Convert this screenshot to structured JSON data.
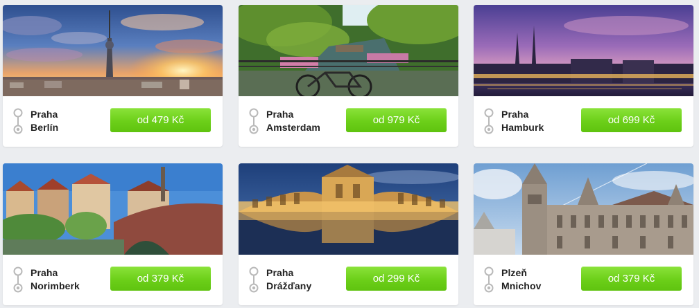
{
  "cards": [
    {
      "from": "Praha",
      "to": "Berlín",
      "price": "od 479 Kč",
      "image": "berlin-skyline-sunset-image"
    },
    {
      "from": "Praha",
      "to": "Amsterdam",
      "price": "od 979 Kč",
      "image": "amsterdam-canal-bicycle-image"
    },
    {
      "from": "Praha",
      "to": "Hamburk",
      "price": "od 699 Kč",
      "image": "hamburg-night-skyline-image"
    },
    {
      "from": "Praha",
      "to": "Norimberk",
      "price": "od 379 Kč",
      "image": "nuremberg-river-bridge-image"
    },
    {
      "from": "Praha",
      "to": "Drážďany",
      "price": "od 299 Kč",
      "image": "dresden-zwinger-reflection-image"
    },
    {
      "from": "Plzeň",
      "to": "Mnichov",
      "price": "od 379 Kč",
      "image": "munich-town-hall-image"
    }
  ],
  "colors": {
    "button": "#6ccf19",
    "background": "#ebedf0",
    "card": "#ffffff",
    "text": "#222222",
    "route_icon": "#b9b9b9"
  },
  "icons": {
    "route": "route-pin-icon"
  }
}
